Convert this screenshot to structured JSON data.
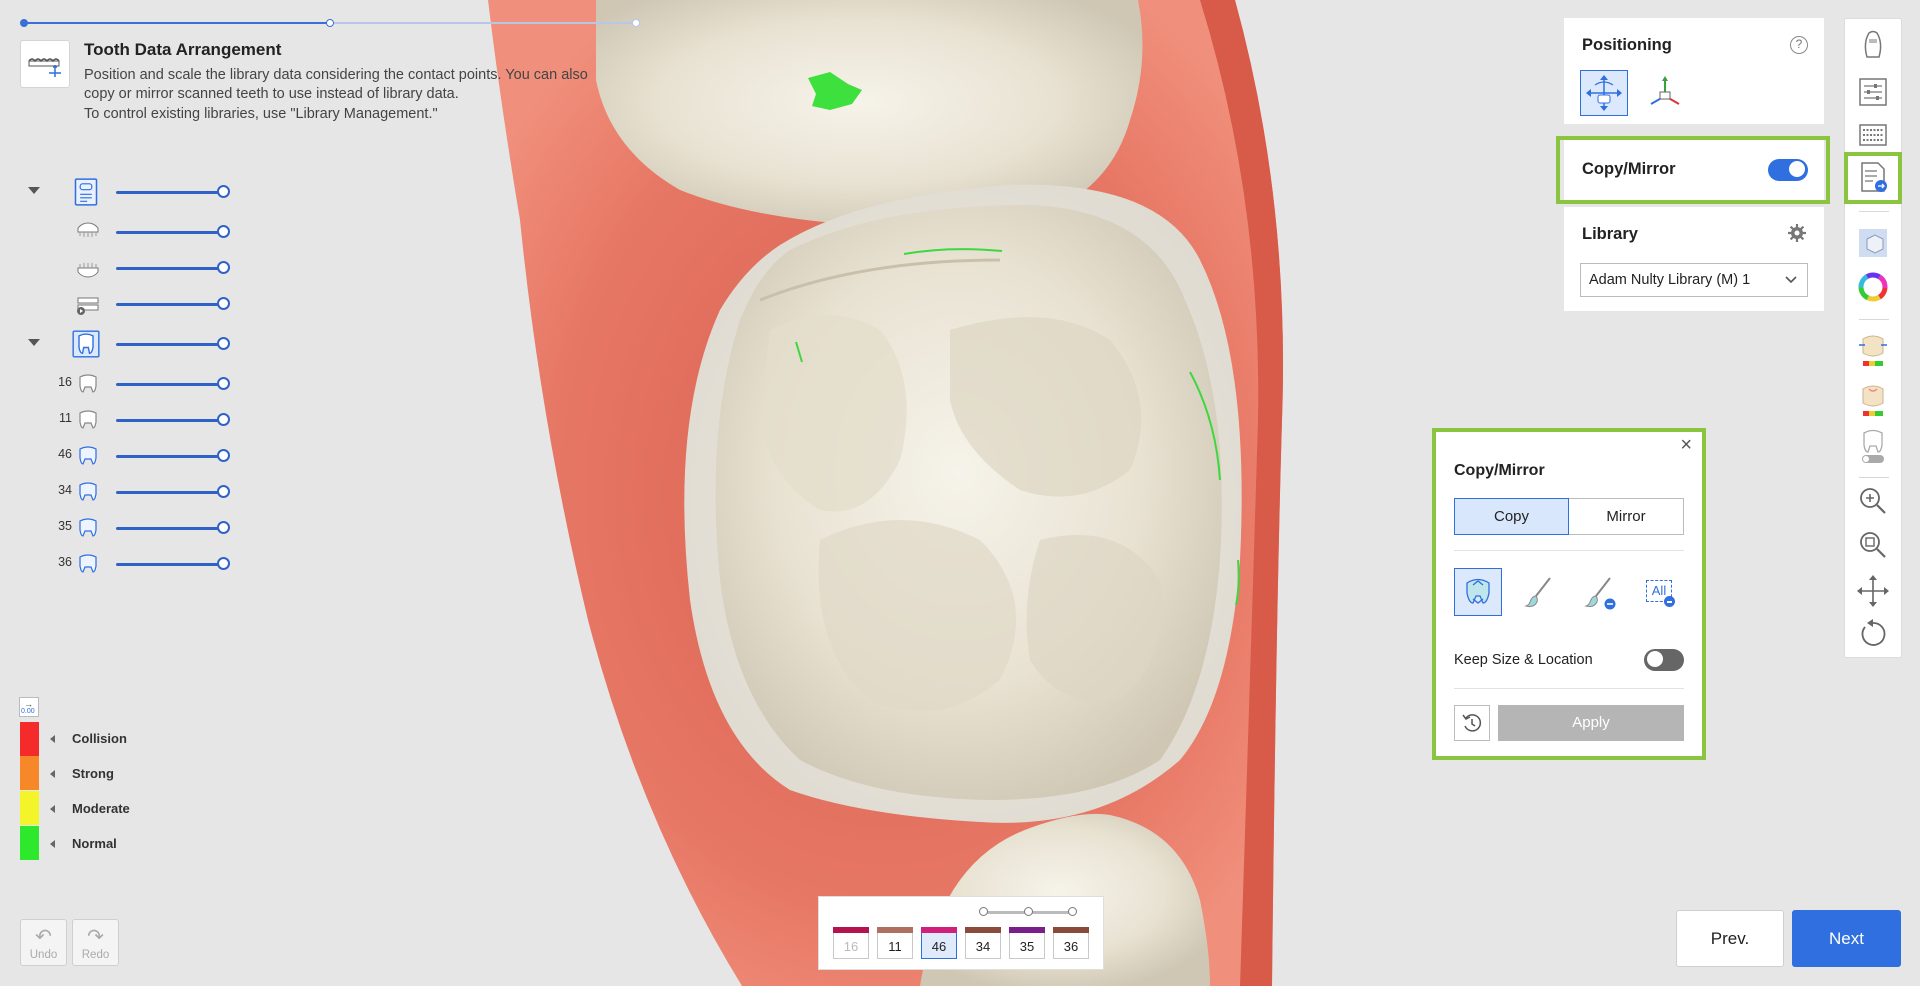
{
  "header": {
    "title": "Tooth Data Arrangement",
    "description_lines": [
      "Position and scale the library data considering the contact points. You can also",
      "copy or mirror scanned teeth to use instead of library data.",
      "To control existing libraries, use \"Library Management.\""
    ]
  },
  "tree": {
    "tooth_numbers": [
      "16",
      "11",
      "46",
      "34",
      "35",
      "36"
    ]
  },
  "legend": {
    "value_label": "0.00",
    "items": [
      {
        "label": "Collision",
        "color": "#f52a2a"
      },
      {
        "label": "Strong",
        "color": "#f7882a"
      },
      {
        "label": "Moderate",
        "color": "#f4f42a"
      },
      {
        "label": "Normal",
        "color": "#2ee82e"
      }
    ]
  },
  "history": {
    "undo_label": "Undo",
    "redo_label": "Redo"
  },
  "tooth_bar": {
    "teeth": [
      {
        "number": "16",
        "color": "#b5134f",
        "disabled": true,
        "selected": false
      },
      {
        "number": "11",
        "color": "#b07060",
        "disabled": false,
        "selected": false
      },
      {
        "number": "46",
        "color": "#d0207a",
        "disabled": false,
        "selected": true
      },
      {
        "number": "34",
        "color": "#8a4b3a",
        "disabled": false,
        "selected": false
      },
      {
        "number": "35",
        "color": "#7a1e8a",
        "disabled": false,
        "selected": false
      },
      {
        "number": "36",
        "color": "#8a4a3a",
        "disabled": false,
        "selected": false
      }
    ]
  },
  "nav": {
    "prev_label": "Prev.",
    "next_label": "Next"
  },
  "positioning": {
    "title": "Positioning",
    "help_label": "?"
  },
  "copy_mirror_panel": {
    "title": "Copy/Mirror",
    "enabled": true
  },
  "library": {
    "title": "Library",
    "selected": "Adam Nulty Library (M) 1"
  },
  "popup": {
    "title": "Copy/Mirror",
    "close_label": "×",
    "copy_label": "Copy",
    "mirror_label": "Mirror",
    "all_label": "All",
    "keep_label": "Keep Size & Location",
    "keep_enabled": false,
    "apply_label": "Apply"
  },
  "colors": {
    "accent": "#2f6fe0",
    "highlight": "#8bc53f",
    "gum": "#e3705f",
    "tooth": "#ebe6d8"
  }
}
